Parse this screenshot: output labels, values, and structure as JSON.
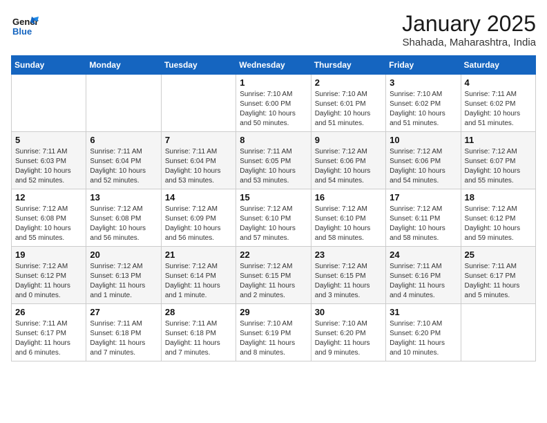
{
  "header": {
    "logo_line1": "General",
    "logo_line2": "Blue",
    "month": "January 2025",
    "location": "Shahada, Maharashtra, India"
  },
  "days_of_week": [
    "Sunday",
    "Monday",
    "Tuesday",
    "Wednesday",
    "Thursday",
    "Friday",
    "Saturday"
  ],
  "weeks": [
    [
      {
        "day": "",
        "info": ""
      },
      {
        "day": "",
        "info": ""
      },
      {
        "day": "",
        "info": ""
      },
      {
        "day": "1",
        "info": "Sunrise: 7:10 AM\nSunset: 6:00 PM\nDaylight: 10 hours\nand 50 minutes."
      },
      {
        "day": "2",
        "info": "Sunrise: 7:10 AM\nSunset: 6:01 PM\nDaylight: 10 hours\nand 51 minutes."
      },
      {
        "day": "3",
        "info": "Sunrise: 7:10 AM\nSunset: 6:02 PM\nDaylight: 10 hours\nand 51 minutes."
      },
      {
        "day": "4",
        "info": "Sunrise: 7:11 AM\nSunset: 6:02 PM\nDaylight: 10 hours\nand 51 minutes."
      }
    ],
    [
      {
        "day": "5",
        "info": "Sunrise: 7:11 AM\nSunset: 6:03 PM\nDaylight: 10 hours\nand 52 minutes."
      },
      {
        "day": "6",
        "info": "Sunrise: 7:11 AM\nSunset: 6:04 PM\nDaylight: 10 hours\nand 52 minutes."
      },
      {
        "day": "7",
        "info": "Sunrise: 7:11 AM\nSunset: 6:04 PM\nDaylight: 10 hours\nand 53 minutes."
      },
      {
        "day": "8",
        "info": "Sunrise: 7:11 AM\nSunset: 6:05 PM\nDaylight: 10 hours\nand 53 minutes."
      },
      {
        "day": "9",
        "info": "Sunrise: 7:12 AM\nSunset: 6:06 PM\nDaylight: 10 hours\nand 54 minutes."
      },
      {
        "day": "10",
        "info": "Sunrise: 7:12 AM\nSunset: 6:06 PM\nDaylight: 10 hours\nand 54 minutes."
      },
      {
        "day": "11",
        "info": "Sunrise: 7:12 AM\nSunset: 6:07 PM\nDaylight: 10 hours\nand 55 minutes."
      }
    ],
    [
      {
        "day": "12",
        "info": "Sunrise: 7:12 AM\nSunset: 6:08 PM\nDaylight: 10 hours\nand 55 minutes."
      },
      {
        "day": "13",
        "info": "Sunrise: 7:12 AM\nSunset: 6:08 PM\nDaylight: 10 hours\nand 56 minutes."
      },
      {
        "day": "14",
        "info": "Sunrise: 7:12 AM\nSunset: 6:09 PM\nDaylight: 10 hours\nand 56 minutes."
      },
      {
        "day": "15",
        "info": "Sunrise: 7:12 AM\nSunset: 6:10 PM\nDaylight: 10 hours\nand 57 minutes."
      },
      {
        "day": "16",
        "info": "Sunrise: 7:12 AM\nSunset: 6:10 PM\nDaylight: 10 hours\nand 58 minutes."
      },
      {
        "day": "17",
        "info": "Sunrise: 7:12 AM\nSunset: 6:11 PM\nDaylight: 10 hours\nand 58 minutes."
      },
      {
        "day": "18",
        "info": "Sunrise: 7:12 AM\nSunset: 6:12 PM\nDaylight: 10 hours\nand 59 minutes."
      }
    ],
    [
      {
        "day": "19",
        "info": "Sunrise: 7:12 AM\nSunset: 6:12 PM\nDaylight: 11 hours\nand 0 minutes."
      },
      {
        "day": "20",
        "info": "Sunrise: 7:12 AM\nSunset: 6:13 PM\nDaylight: 11 hours\nand 1 minute."
      },
      {
        "day": "21",
        "info": "Sunrise: 7:12 AM\nSunset: 6:14 PM\nDaylight: 11 hours\nand 1 minute."
      },
      {
        "day": "22",
        "info": "Sunrise: 7:12 AM\nSunset: 6:15 PM\nDaylight: 11 hours\nand 2 minutes."
      },
      {
        "day": "23",
        "info": "Sunrise: 7:12 AM\nSunset: 6:15 PM\nDaylight: 11 hours\nand 3 minutes."
      },
      {
        "day": "24",
        "info": "Sunrise: 7:11 AM\nSunset: 6:16 PM\nDaylight: 11 hours\nand 4 minutes."
      },
      {
        "day": "25",
        "info": "Sunrise: 7:11 AM\nSunset: 6:17 PM\nDaylight: 11 hours\nand 5 minutes."
      }
    ],
    [
      {
        "day": "26",
        "info": "Sunrise: 7:11 AM\nSunset: 6:17 PM\nDaylight: 11 hours\nand 6 minutes."
      },
      {
        "day": "27",
        "info": "Sunrise: 7:11 AM\nSunset: 6:18 PM\nDaylight: 11 hours\nand 7 minutes."
      },
      {
        "day": "28",
        "info": "Sunrise: 7:11 AM\nSunset: 6:18 PM\nDaylight: 11 hours\nand 7 minutes."
      },
      {
        "day": "29",
        "info": "Sunrise: 7:10 AM\nSunset: 6:19 PM\nDaylight: 11 hours\nand 8 minutes."
      },
      {
        "day": "30",
        "info": "Sunrise: 7:10 AM\nSunset: 6:20 PM\nDaylight: 11 hours\nand 9 minutes."
      },
      {
        "day": "31",
        "info": "Sunrise: 7:10 AM\nSunset: 6:20 PM\nDaylight: 11 hours\nand 10 minutes."
      },
      {
        "day": "",
        "info": ""
      }
    ]
  ]
}
